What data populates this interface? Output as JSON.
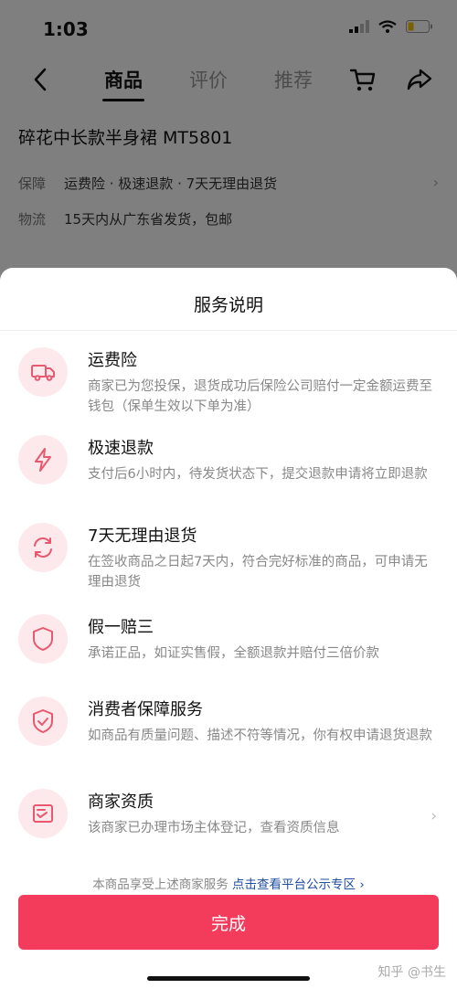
{
  "status_bar": {
    "time": "1:03"
  },
  "navbar": {
    "tabs": [
      {
        "label": "商品",
        "active": true
      },
      {
        "label": "评价",
        "active": false
      },
      {
        "label": "推荐",
        "active": false
      }
    ]
  },
  "product": {
    "title": "碎花中长款半身裙 MT5801",
    "guarantee_label": "保障",
    "guarantee_value": "运费险 · 极速退款 · 7天无理由退货",
    "logistics_label": "物流",
    "logistics_value": "15天内从广东省发货，包邮"
  },
  "sheet": {
    "title": "服务说明",
    "services": [
      {
        "name": "运费险",
        "desc": "商家已为您投保，退货成功后保险公司赔付一定金额运费至钱包（保单生效以下单为准）",
        "icon": "truck-icon"
      },
      {
        "name": "极速退款",
        "desc": "支付后6小时内，待发货状态下，提交退款申请将立即退款",
        "icon": "lightning-icon"
      },
      {
        "name": "7天无理由退货",
        "desc": "在签收商品之日起7天内，符合完好标准的商品，可申请无理由退货",
        "icon": "refresh-icon"
      },
      {
        "name": "假一赔三",
        "desc": "承诺正品，如证实售假，全额退款并赔付三倍价款",
        "icon": "shield-icon"
      },
      {
        "name": "消费者保障服务",
        "desc": "如商品有质量问题、描述不符等情况，你有权申请退货退款",
        "icon": "shield-check-icon"
      },
      {
        "name": "商家资质",
        "desc": "该商家已办理市场主体登记，查看资质信息",
        "icon": "license-icon"
      }
    ],
    "footer_text": "本商品享受上述商家服务",
    "footer_link": "点击查看平台公示专区",
    "done_label": "完成",
    "watermark": "知乎 @书生"
  },
  "colors": {
    "accent": "#f33c5c",
    "icon_bg": "#fde9ec",
    "icon_stroke": "#e8596f",
    "link": "#1f4fa0"
  }
}
